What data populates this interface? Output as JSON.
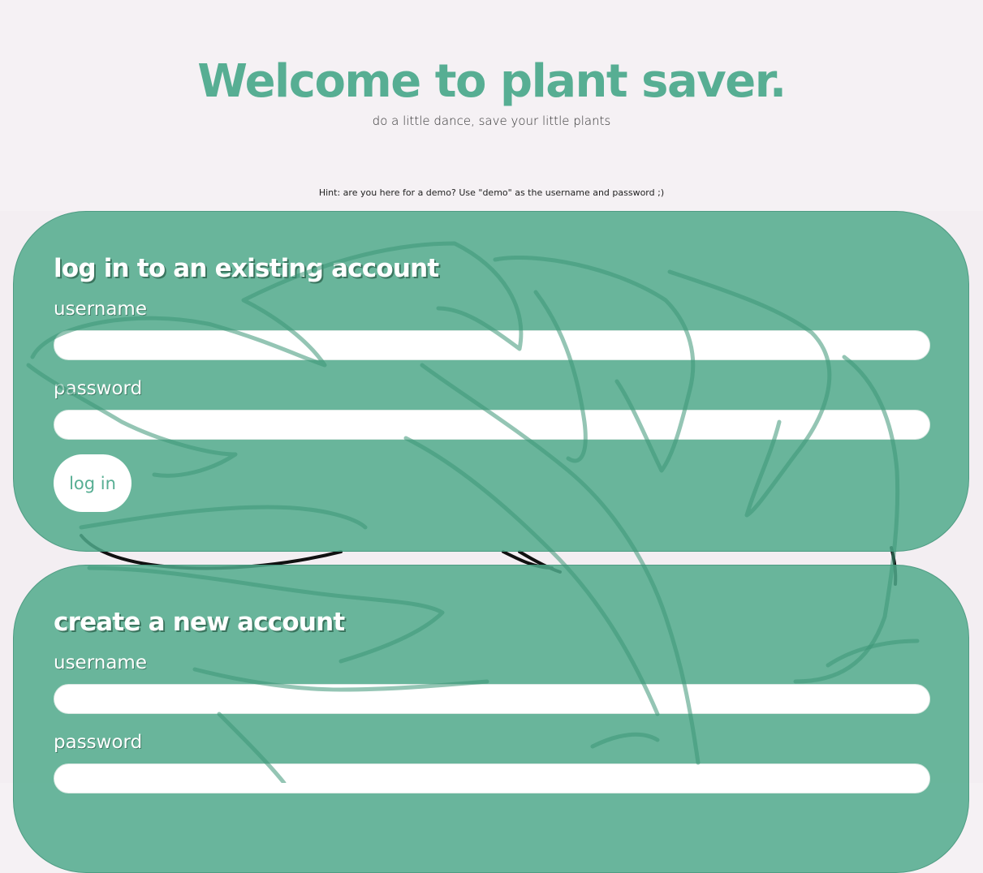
{
  "header": {
    "title": "Welcome to plant saver.",
    "subtitle": "do a little dance, save your little plants",
    "hint": "Hint: are you here for a demo? Use \"demo\" as the username and password ;)"
  },
  "login": {
    "heading": "log in to an existing account",
    "username_label": "username",
    "username_value": "",
    "password_label": "password",
    "password_value": "",
    "submit_label": "log in"
  },
  "register": {
    "heading": "create a new account",
    "username_label": "username",
    "username_value": "",
    "password_label": "password",
    "password_value": ""
  },
  "colors": {
    "accent": "#57ae93",
    "card": "#6bbba3",
    "background": "#f5f1f4",
    "leaf_outline": "#4a9f84"
  },
  "decorations": {
    "background_art": "monstera-leaf-outline-icon"
  }
}
